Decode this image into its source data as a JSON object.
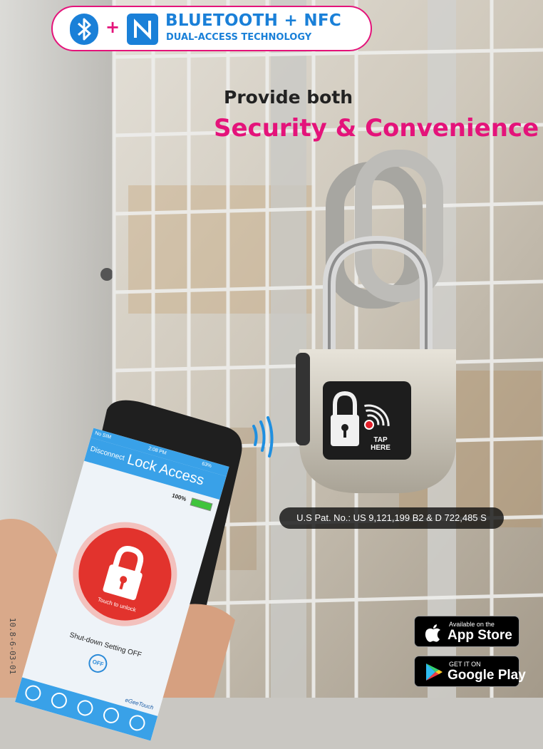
{
  "badge": {
    "line1": "BLUETOOTH + NFC",
    "line2": "DUAL-ACCESS TECHNOLOGY",
    "plus": "+",
    "icons": [
      "bluetooth-icon",
      "nfc-icon"
    ]
  },
  "headline": {
    "line1": "Provide both",
    "line2": "Security & Convenience"
  },
  "padlock": {
    "tap_text_1": "TAP",
    "tap_text_2": "HERE"
  },
  "patent": "U.S Pat. No.:  US 9,121,199 B2 & D 722,485 S",
  "phone_app": {
    "status_left": "No SIM",
    "status_time": "2:08 PM",
    "status_right": "63%",
    "disconnect": "Disconnect",
    "title": "Lock Access",
    "battery": "100%",
    "touch_hint": "Touch to unlock",
    "shutdown": "Shut-down Setting OFF",
    "off": "OFF",
    "brand": "eGeeTouch"
  },
  "stores": {
    "apple_small": "Available on the",
    "apple_big": "App Store",
    "google_small": "GET IT ON",
    "google_big": "Google Play"
  },
  "side_code": "10.8-6-03-01",
  "colors": {
    "accent_pink": "#e4137a",
    "accent_blue": "#1a80d8",
    "app_blue": "#39a1e8",
    "lock_red": "#e2332d"
  }
}
